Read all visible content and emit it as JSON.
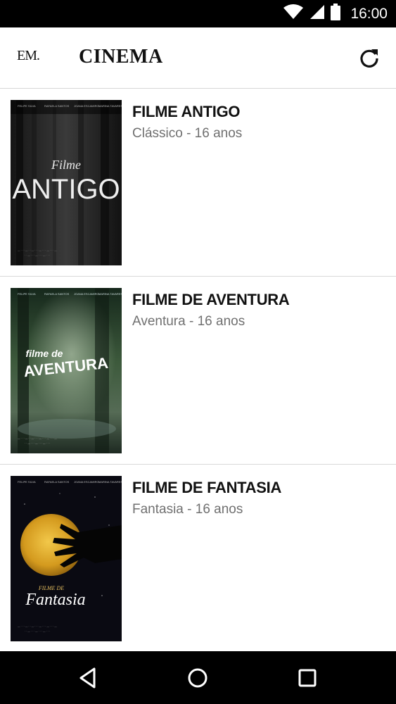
{
  "status_bar": {
    "time": "16:00",
    "icons": [
      "wifi-icon",
      "cell-signal-icon",
      "battery-icon"
    ]
  },
  "app_bar": {
    "logo": "EM.",
    "title": "CINEMA",
    "refresh_icon": "refresh-icon"
  },
  "movies": [
    {
      "title": "FILME ANTIGO",
      "subtitle": "Clássico - 16 anos",
      "poster": {
        "script_text": "Filme",
        "main_text": "ANTIGO"
      }
    },
    {
      "title": "FILME DE AVENTURA",
      "subtitle": "Aventura - 16 anos",
      "poster": {
        "script_text": "filme de",
        "main_text": "AVENTURA"
      }
    },
    {
      "title": "FILME DE FANTASIA",
      "subtitle": "Fantasia - 16 anos",
      "poster": {
        "script_text": "FILME DE",
        "main_text": "Fantasia"
      }
    }
  ],
  "nav_bar": {
    "icons": [
      "back-icon",
      "home-icon",
      "recents-icon"
    ]
  },
  "colors": {
    "status_bar": "#000000",
    "subtitle": "#707070",
    "divider": "#d9d9d9"
  }
}
